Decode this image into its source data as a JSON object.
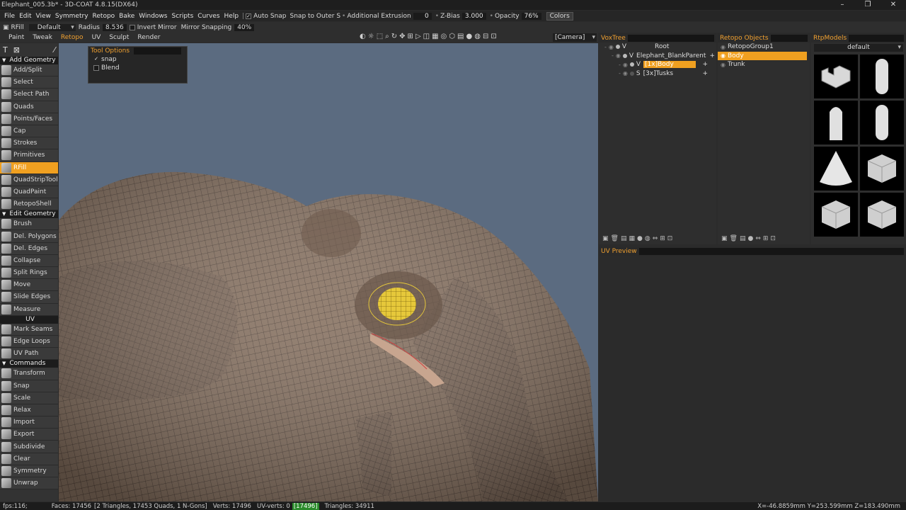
{
  "title": "Elephant_005.3b* - 3D-COAT 4.8.15(DX64)",
  "window_controls": [
    "–",
    "❐",
    "✕"
  ],
  "menu": [
    "File",
    "Edit",
    "View",
    "Symmetry",
    "Retopo",
    "Bake",
    "Windows",
    "Scripts",
    "Curves",
    "Help"
  ],
  "menu_opts": {
    "auto_snap": "Auto Snap",
    "snap_to": "Snap to Outer S",
    "extrusion_label": "Additional Extrusion",
    "extrusion_value": "0",
    "zbias_label": "Z-Bias",
    "zbias_value": "3.000",
    "opacity_label": "Opacity",
    "opacity_value": "76%",
    "colors_btn": "Colors"
  },
  "toolbar2": {
    "tool": "RFill",
    "preset": "Default",
    "radius_label": "Radius",
    "radius_value": "8.536",
    "invert_mirror": "Invert Mirror",
    "mirror_snapping_label": "Mirror Snapping",
    "mirror_snapping_value": "40%"
  },
  "tabs": [
    "Paint",
    "Tweak",
    "Retopo",
    "UV",
    "Sculpt",
    "Render"
  ],
  "camera": "[Camera]",
  "tool_options": {
    "title": "Tool Options",
    "snap": "snap",
    "blend": "Blend"
  },
  "sections": {
    "add_geometry": "Add Geometry",
    "edit_geometry": "Edit Geometry",
    "uv": "UV",
    "commands": "Commands"
  },
  "tools_add": [
    "Add/Split",
    "Select",
    "Select Path",
    "Quads",
    "Points/Faces",
    "Cap",
    "Strokes",
    "Primitives",
    "RFill",
    "QuadStripTool",
    "QuadPaint",
    "RetopoShell"
  ],
  "tools_edit": [
    "Brush",
    "Del. Polygons",
    "Del. Edges",
    "Collapse",
    "Split Rings",
    "Move",
    "Slide Edges",
    "Measure"
  ],
  "tools_uv": [
    "Mark Seams",
    "Edge Loops",
    "UV Path"
  ],
  "tools_cmd": [
    "Transform",
    "Snap",
    "Scale",
    "Relax",
    "Import",
    "Export",
    "Subdivide",
    "Clear",
    "Symmetry",
    "Unwrap"
  ],
  "voxtree": {
    "title": "VoxTree",
    "rows": [
      {
        "label": "Root",
        "tag": "V"
      },
      {
        "label": "Elephant_BlankParent",
        "tag": "V"
      },
      {
        "label": "[1x]Body",
        "tag": "V"
      },
      {
        "label": "[3x]Tusks",
        "tag": "S"
      }
    ]
  },
  "retopo": {
    "title": "Retopo Objects",
    "items": [
      "RetopoGroup1",
      "Body",
      "Trunk"
    ]
  },
  "rtpmodels": {
    "title": "RtpModels",
    "preset": "default"
  },
  "uv_preview": {
    "title": "UV Preview"
  },
  "status": {
    "fps": "fps:116;",
    "faces": "Faces: 17456",
    "faces_detail": "[2 Triangles, 17453 Quads, 1 N-Gons]",
    "verts": "Verts: 17496",
    "uv_verts_label": "UV-verts: 0",
    "uv_verts_value": "[17496]",
    "triangles": "Triangles: 34911",
    "coords": "X=-46.8859mm  Y=253.599mm  Z=183.490mm"
  },
  "colors": {
    "accent": "#f0a020",
    "viewport_bg": "#5b6b80",
    "mesh": "#8a7566",
    "selection": "#e8d040"
  }
}
